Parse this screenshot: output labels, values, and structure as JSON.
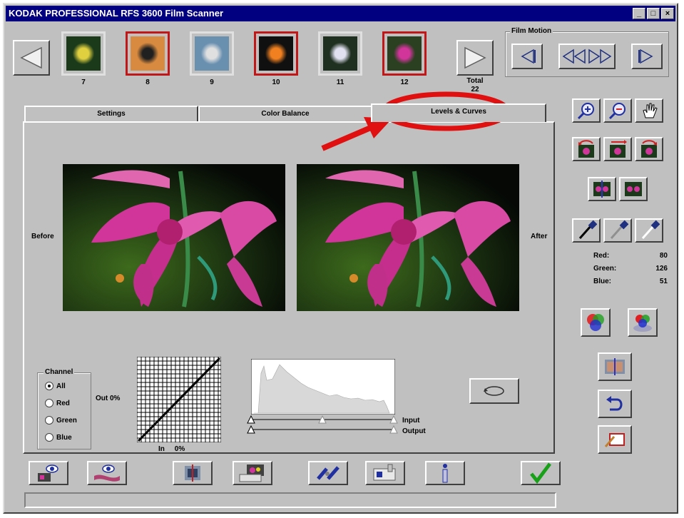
{
  "window": {
    "title": "KODAK PROFESSIONAL RFS 3600 Film Scanner",
    "min_label": "_",
    "max_label": "□",
    "close_label": "×"
  },
  "filmstrip": {
    "frames": [
      {
        "number": "7",
        "selected": false
      },
      {
        "number": "8",
        "selected": true
      },
      {
        "number": "9",
        "selected": false
      },
      {
        "number": "10",
        "selected": true
      },
      {
        "number": "11",
        "selected": false
      },
      {
        "number": "12",
        "selected": true
      }
    ],
    "total_label": "Total",
    "total_value": "22"
  },
  "film_motion": {
    "label": "Film Motion"
  },
  "tabs": {
    "settings": "Settings",
    "color_balance": "Color Balance",
    "levels_curves": "Levels & Curves"
  },
  "preview": {
    "before_label": "Before",
    "after_label": "After"
  },
  "channel": {
    "group_label": "Channel",
    "options": [
      "All",
      "Red",
      "Green",
      "Blue"
    ],
    "selected": "All"
  },
  "curve": {
    "out_label": "Out  0%",
    "in_label": "In     0%"
  },
  "histogram": {
    "input_label": "Input",
    "output_label": "Output"
  },
  "readout": {
    "red_label": "Red:",
    "red_value": "80",
    "green_label": "Green:",
    "green_value": "126",
    "blue_label": "Blue:",
    "blue_value": "51"
  },
  "colors": {
    "title_bg": "#000080",
    "face": "#c0c0c0",
    "annotation_red": "#e01010"
  }
}
